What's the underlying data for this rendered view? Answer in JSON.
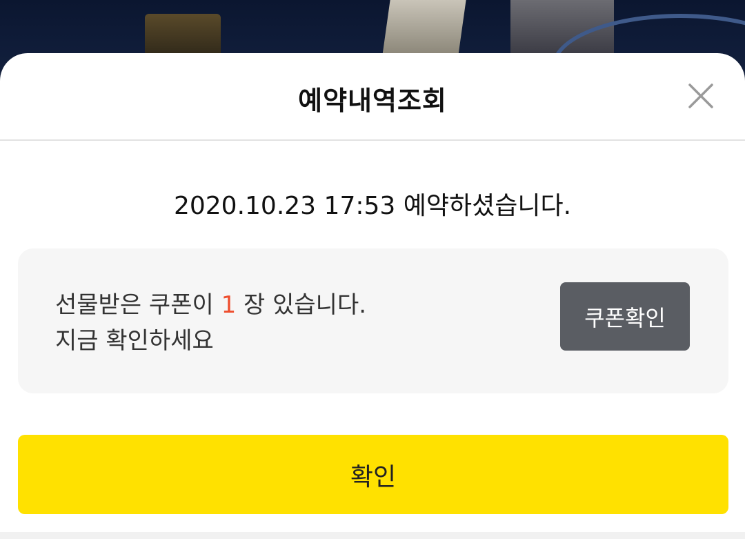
{
  "modal": {
    "title": "예약내역조회",
    "close_icon": "close-icon",
    "reservation_message": "2020.10.23 17:53 예약하셨습니다."
  },
  "coupon": {
    "line1_prefix": "선물받은 쿠폰이 ",
    "count": "1",
    "line1_suffix": " 장 있습니다.",
    "line2": "지금 확인하세요",
    "button_label": "쿠폰확인"
  },
  "confirm_button_label": "확인",
  "colors": {
    "accent_yellow": "#ffe100",
    "coupon_count": "#ee4d2d",
    "coupon_button_bg": "#5a5d63",
    "coupon_box_bg": "#f6f6f6"
  }
}
